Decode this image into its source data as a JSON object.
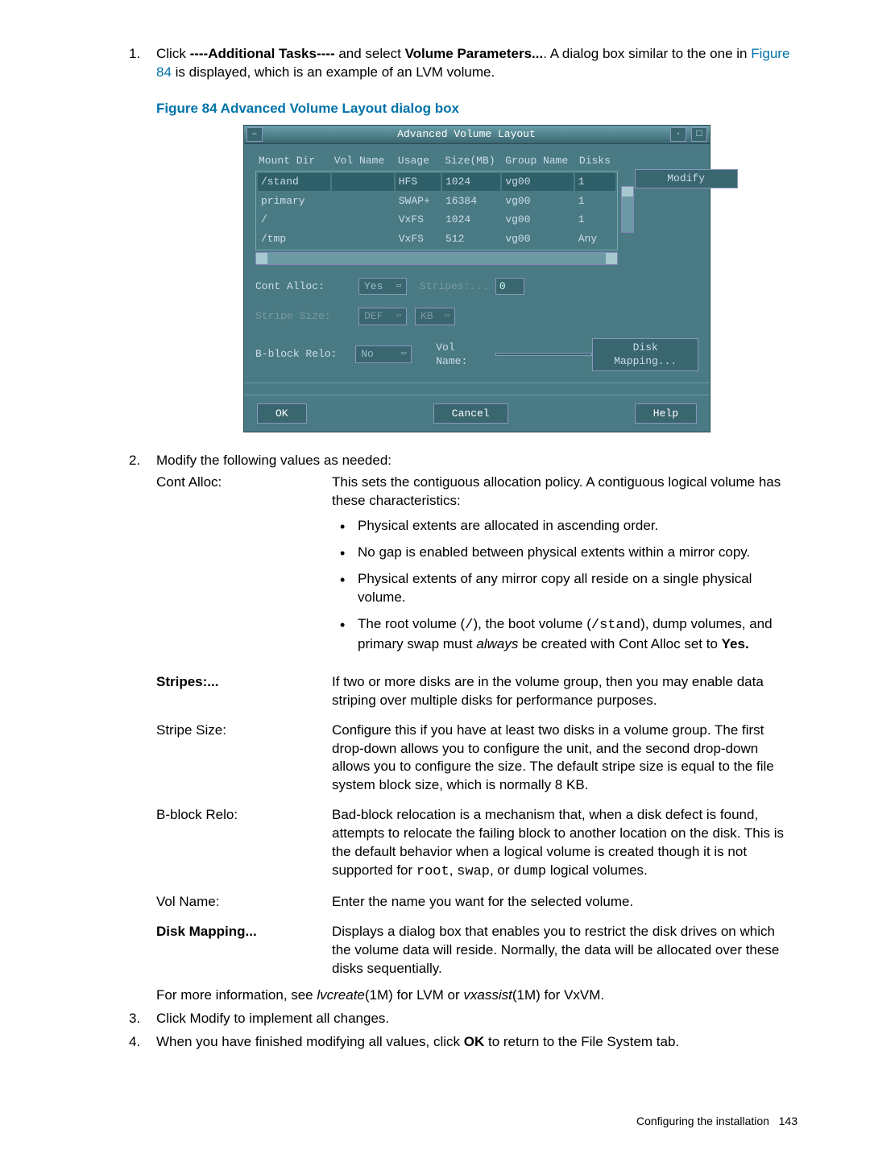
{
  "step1": {
    "pre": "Click ",
    "task_label": "----Additional Tasks----",
    "mid": " and select ",
    "param_label": "Volume Parameters...",
    "post1": ". A dialog box similar to the one in ",
    "fig_ref": "Figure 84",
    "post2": " is displayed, which is an example of an LVM volume."
  },
  "figure_caption": "Figure 84 Advanced Volume Layout dialog box",
  "dialog": {
    "title": "Advanced Volume Layout",
    "headers": {
      "mount": "Mount Dir",
      "vol": "Vol Name",
      "usage": "Usage",
      "size": "Size(MB)",
      "group": "Group Name",
      "disks": "Disks"
    },
    "rows": [
      {
        "mount": "/stand",
        "vol": "",
        "usage": "HFS",
        "size": "1024",
        "group": "vg00",
        "disks": "1",
        "sel": true
      },
      {
        "mount": "primary",
        "vol": "",
        "usage": "SWAP+",
        "size": "16384",
        "group": "vg00",
        "disks": "1"
      },
      {
        "mount": "/",
        "vol": "",
        "usage": "VxFS",
        "size": "1024",
        "group": "vg00",
        "disks": "1"
      },
      {
        "mount": "/tmp",
        "vol": "",
        "usage": "VxFS",
        "size": "512",
        "group": "vg00",
        "disks": "Any"
      }
    ],
    "modify_btn": "Modify",
    "cont_alloc_label": "Cont Alloc:",
    "cont_alloc_value": "Yes",
    "stripes_label": "Stripes:...",
    "stripes_value": "0",
    "stripe_size_label": "Stripe Size:",
    "stripe_size_unit": "DEF",
    "stripe_size_scale": "KB",
    "bblock_label": "B-block Relo:",
    "bblock_value": "No",
    "volname_label": "Vol Name:",
    "volname_value": "",
    "disk_mapping_btn": "Disk Mapping...",
    "ok": "OK",
    "cancel": "Cancel",
    "help": "Help"
  },
  "step2": {
    "lead": "Modify the following values as needed:",
    "items": {
      "cont_alloc": {
        "term": "Cont Alloc:",
        "desc": "This sets the contiguous allocation policy. A contiguous logical volume has these characteristics:",
        "b1": "Physical extents are allocated in ascending order.",
        "b2": "No gap is enabled between physical extents within a mirror copy.",
        "b3": "Physical extents of any mirror copy all reside on a single physical volume.",
        "b4_pre": "The root volume (",
        "b4_root": "/",
        "b4_mid1": "), the boot volume (",
        "b4_stand": "/stand",
        "b4_mid2": "), dump volumes, and primary swap must ",
        "b4_always": "always",
        "b4_mid3": " be created with Cont Alloc set to ",
        "b4_yes": "Yes."
      },
      "stripes": {
        "term": "Stripes:...",
        "desc": "If two or more disks are in the volume group, then you may enable data striping over multiple disks for performance purposes."
      },
      "stripe_size": {
        "term": "Stripe Size:",
        "desc": "Configure this if you have at least two disks in a volume group. The first drop-down allows you to configure the unit, and the second drop-down allows you to configure the size. The default stripe size is equal to the file system block size, which is normally 8 KB."
      },
      "bblock": {
        "term": "B-block Relo:",
        "desc_pre": "Bad-block relocation is a mechanism that, when a disk defect is found, attempts to relocate the failing block to another location on the disk. This is the default behavior when a logical volume is created though it is not supported for ",
        "c1": "root",
        "s1": ", ",
        "c2": "swap",
        "s2": ", or ",
        "c3": "dump",
        "desc_post": " logical volumes."
      },
      "volname": {
        "term": "Vol Name:",
        "desc": "Enter the name you want for the selected volume."
      },
      "diskmap": {
        "term": "Disk Mapping...",
        "desc": "Displays a dialog box that enables you to restrict the disk drives on which the volume data will reside. Normally, the data will be allocated over these disks sequentially."
      }
    },
    "footer_line_pre": "For more information, see ",
    "footer_i1": "lvcreate",
    "footer_mid1": "(1M) for LVM or ",
    "footer_i2": "vxassist",
    "footer_mid2": "(1M) for VxVM."
  },
  "step3": "Click Modify to implement all changes.",
  "step4_pre": "When you have finished modifying all values, click ",
  "step4_ok": "OK",
  "step4_post": " to return to the File System tab.",
  "footer": {
    "text": "Configuring the installation",
    "page": "143"
  }
}
